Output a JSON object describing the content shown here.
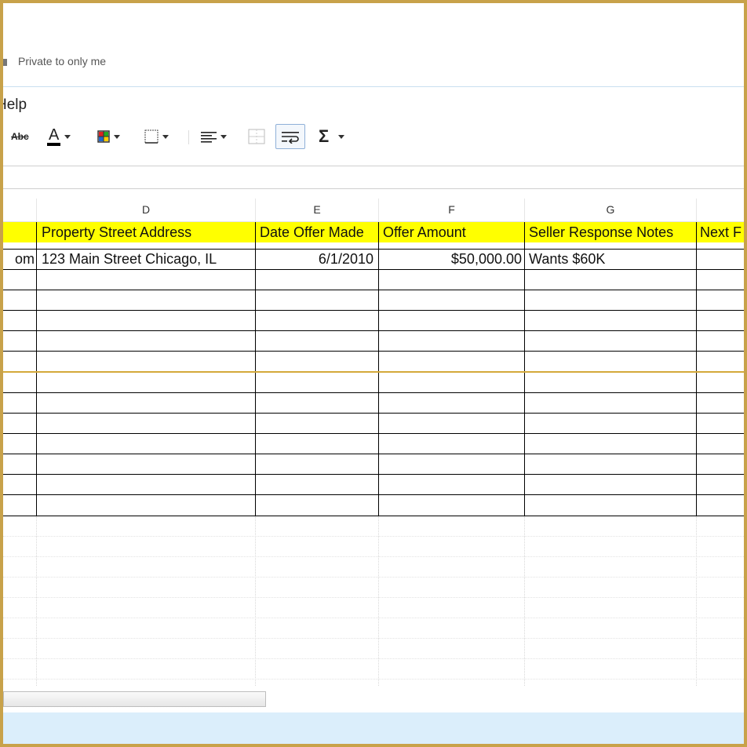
{
  "header": {
    "privacy_label": "Private to only me"
  },
  "menu": {
    "help_label": "Help",
    "help_visible": "Help"
  },
  "toolbar": {
    "strikethrough_label": "Abc",
    "text_color_label": "A",
    "sum_label": "Σ"
  },
  "columns": [
    "D",
    "E",
    "F",
    "G"
  ],
  "headers": {
    "partial": "",
    "d": "Property Street Address",
    "e": "Date Offer Made",
    "f": "Offer Amount",
    "g": "Seller Response Notes",
    "h": "Next F"
  },
  "row1": {
    "partial": "om",
    "d": "123 Main Street Chicago, IL",
    "e": "6/1/2010",
    "f": "$50,000.00",
    "g": "Wants $60K",
    "h": ""
  },
  "colors": {
    "header_fill": "#ffff00",
    "selection": "#d4a93a",
    "statusbar": "#dbeefb"
  }
}
